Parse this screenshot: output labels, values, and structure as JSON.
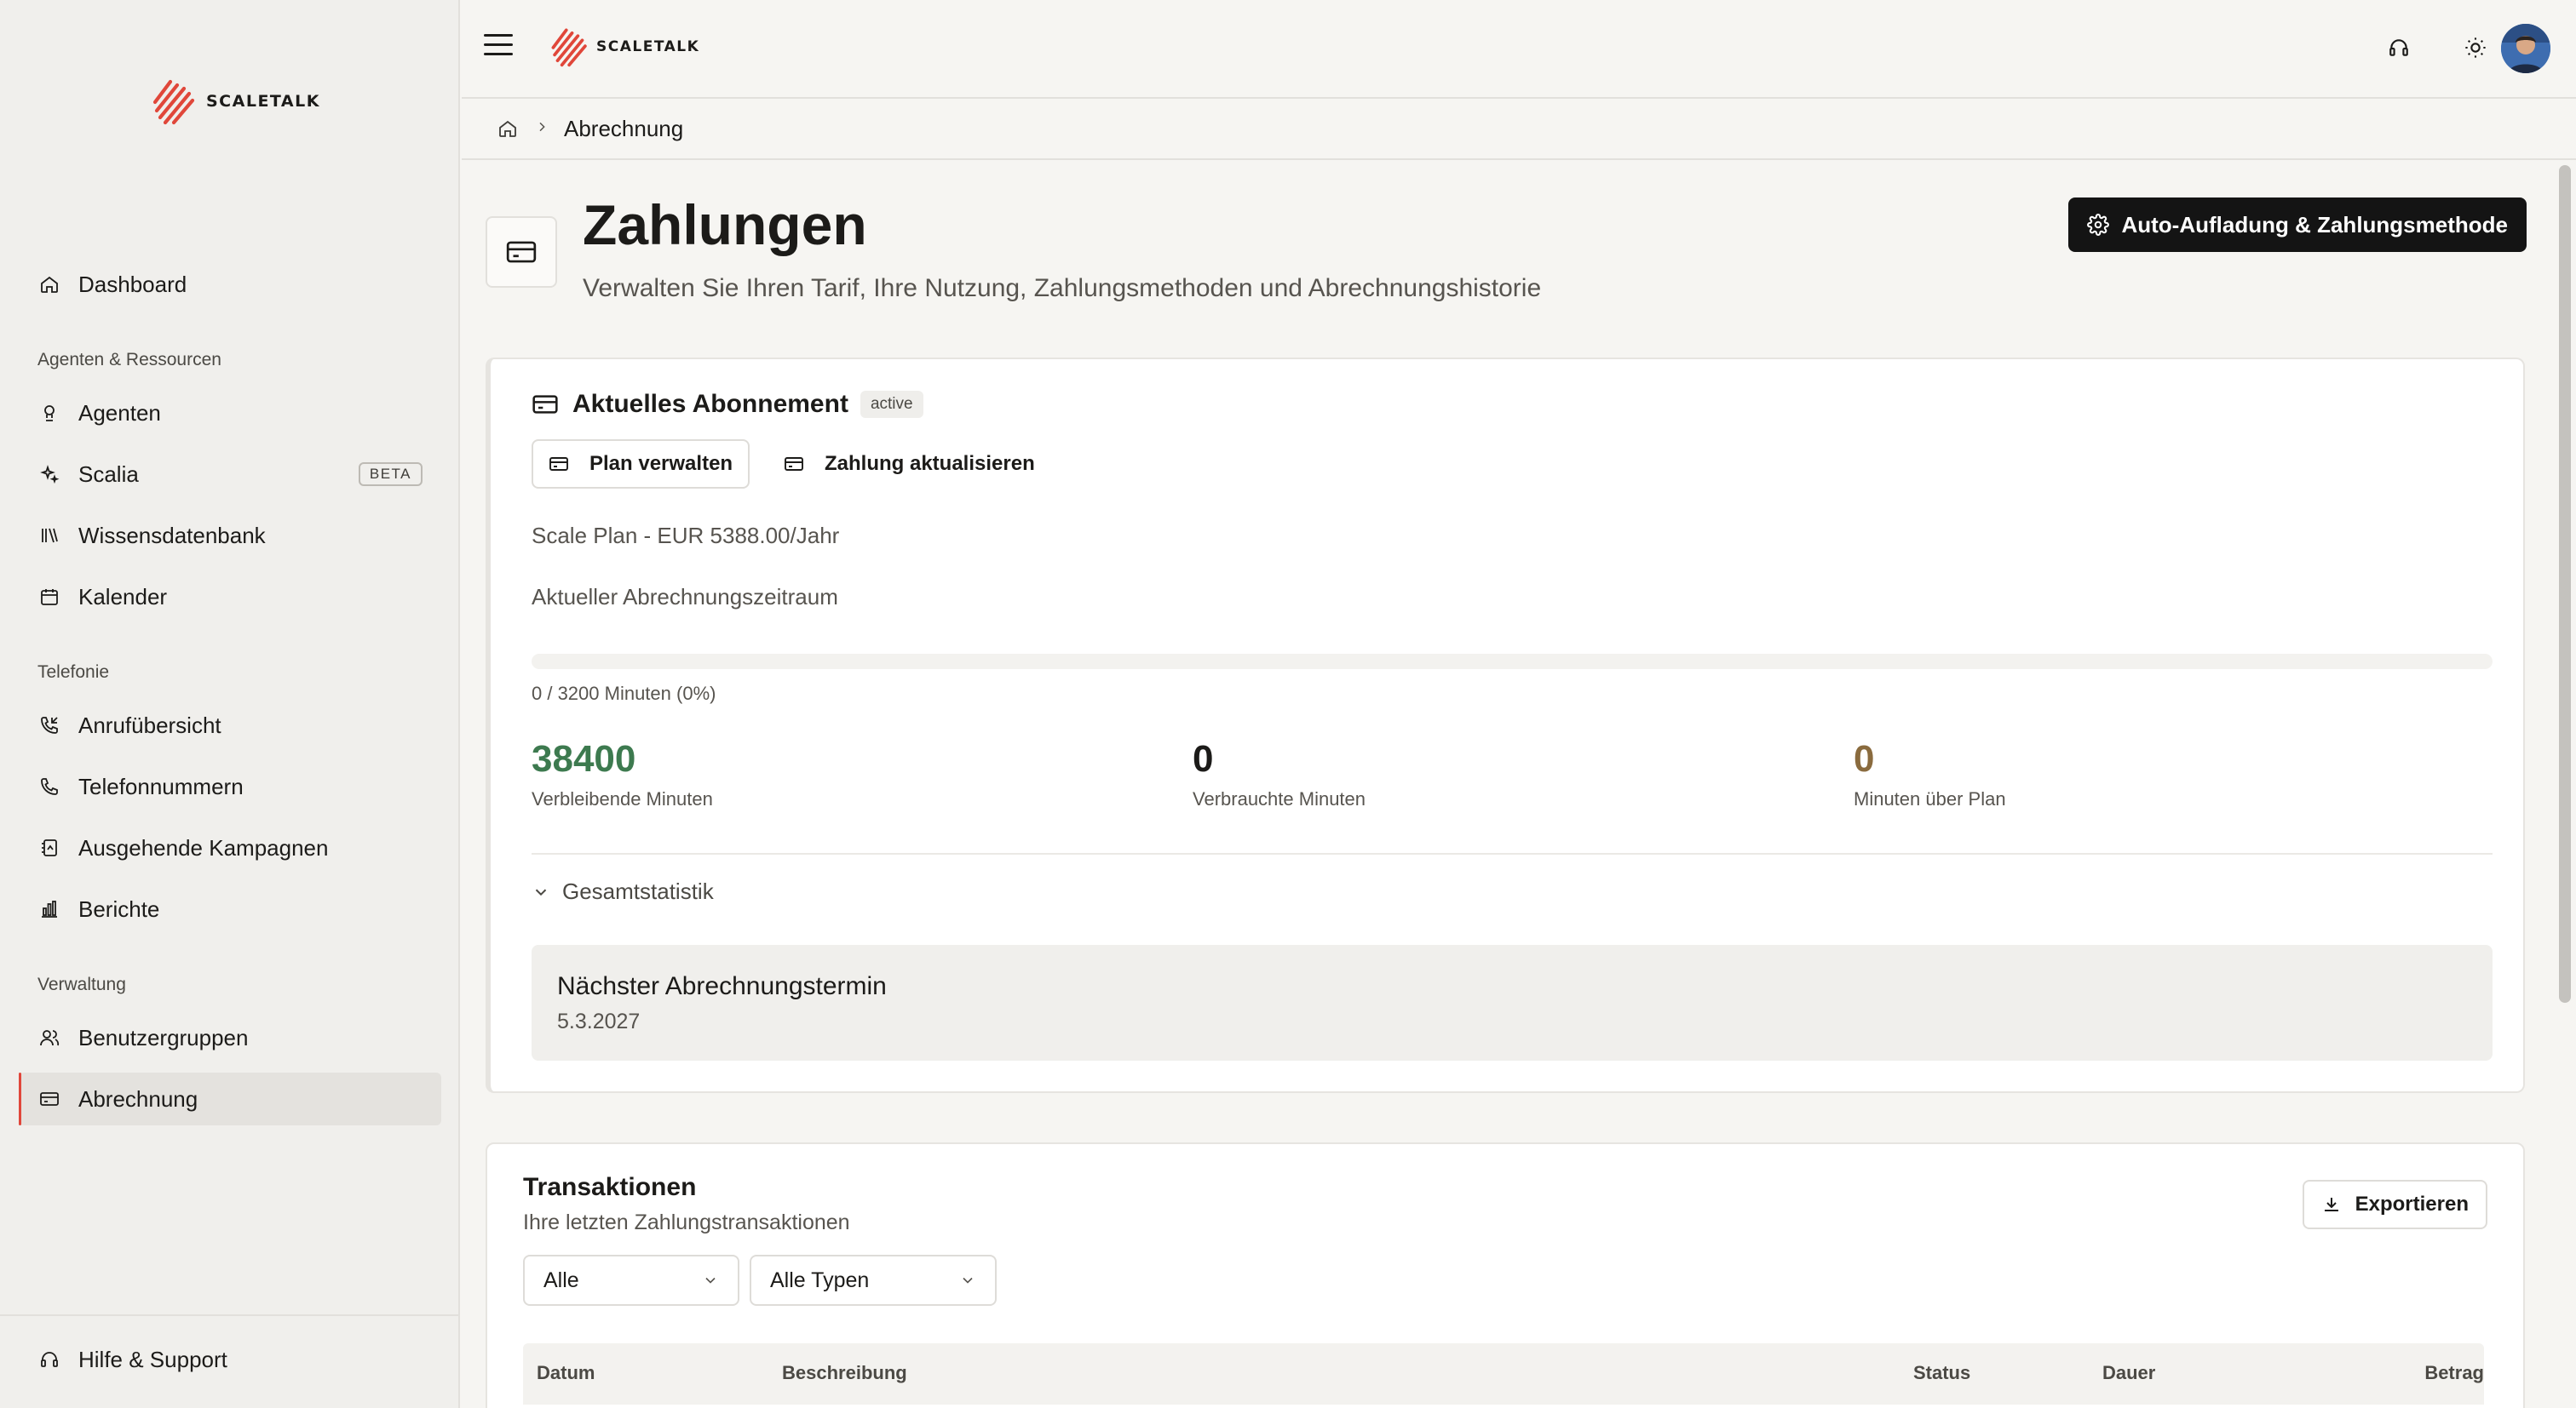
{
  "brand": {
    "name": "SCALETALK",
    "accent": "#e0473a"
  },
  "sidebar": {
    "items": [
      {
        "label": "Dashboard",
        "icon": "home-icon"
      },
      {
        "label": "Agenten",
        "icon": "agent-icon"
      },
      {
        "label": "Scalia",
        "icon": "sparkles-icon",
        "badge": "BETA"
      },
      {
        "label": "Wissensdatenbank",
        "icon": "library-icon"
      },
      {
        "label": "Kalender",
        "icon": "calendar-icon"
      },
      {
        "label": "Anrufübersicht",
        "icon": "phone-incoming-icon"
      },
      {
        "label": "Telefonnummern",
        "icon": "phone-icon"
      },
      {
        "label": "Ausgehende Kampagnen",
        "icon": "campaign-icon"
      },
      {
        "label": "Berichte",
        "icon": "bar-chart-icon"
      },
      {
        "label": "Benutzergruppen",
        "icon": "users-icon"
      },
      {
        "label": "Abrechnung",
        "icon": "credit-card-icon",
        "active": true
      }
    ],
    "sections": [
      "Agenten & Ressourcen",
      "Telefonie",
      "Verwaltung"
    ],
    "help_label": "Hilfe & Support"
  },
  "breadcrumb": {
    "current": "Abrechnung"
  },
  "page": {
    "title": "Zahlungen",
    "subtitle": "Verwalten Sie Ihren Tarif, Ihre Nutzung, Zahlungsmethoden und Abrechnungshistorie",
    "primary_button": "Auto-Aufladung & Zahlungsmethode"
  },
  "subscription": {
    "title": "Aktuelles Abonnement",
    "status": "active",
    "manage_plan_label": "Plan verwalten",
    "update_payment_label": "Zahlung aktualisieren",
    "plan": "Scale Plan - EUR 5388.00/Jahr",
    "period_label": "Aktueller Abrechnungszeitraum",
    "usage_fraction": 0,
    "usage_text": "0 / 3200 Minuten (0%)",
    "stats": [
      {
        "value": "38400",
        "label": "Verbleibende Minuten",
        "color": "#3d7a4f"
      },
      {
        "value": "0",
        "label": "Verbrauchte Minuten",
        "color": "#1c1b19"
      },
      {
        "value": "0",
        "label": "Minuten über Plan",
        "color": "#8a6b3e"
      }
    ],
    "overall_stats_label": "Gesamtstatistik",
    "next_billing_title": "Nächster Abrechnungstermin",
    "next_billing_date": "5.3.2027"
  },
  "transactions": {
    "title": "Transaktionen",
    "subtitle": "Ihre letzten Zahlungstransaktionen",
    "export_label": "Exportieren",
    "filter_status": "Alle",
    "filter_type": "Alle Typen",
    "columns": [
      "Datum",
      "Beschreibung",
      "Status",
      "Dauer",
      "Betrag"
    ]
  }
}
